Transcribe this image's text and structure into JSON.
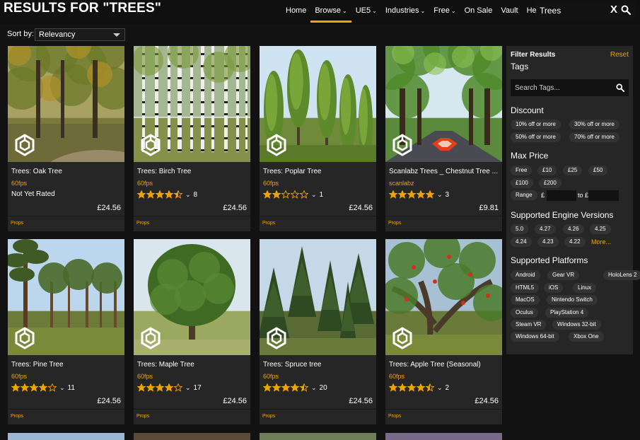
{
  "header": {
    "title": "RESULTS FOR \"TREES\"",
    "nav": [
      {
        "label": "Home",
        "caret": false,
        "active": false
      },
      {
        "label": "Browse",
        "caret": true,
        "active": true
      },
      {
        "label": "UE5",
        "caret": true,
        "active": false
      },
      {
        "label": "Industries",
        "caret": true,
        "active": false
      },
      {
        "label": "Free",
        "caret": true,
        "active": false
      },
      {
        "label": "On Sale",
        "caret": false,
        "active": false
      },
      {
        "label": "Vault",
        "caret": false,
        "active": false
      },
      {
        "label": "Help",
        "caret": false,
        "active": false
      }
    ],
    "search_value": "Trees",
    "clear_glyph": "X"
  },
  "sort": {
    "label": "Sort by:",
    "selected": "Relevancy"
  },
  "products": [
    {
      "title": "Trees: Oak Tree",
      "seller": "60fps",
      "rating": null,
      "unrated_text": "Not Yet Rated",
      "count": "",
      "price": "£24.56",
      "category": "Props",
      "scene": "oak"
    },
    {
      "title": "Trees: Birch Tree",
      "seller": "60fps",
      "rating": 4.5,
      "unrated_text": "",
      "count": "8",
      "price": "£24.56",
      "category": "Props",
      "scene": "birch"
    },
    {
      "title": "Trees: Poplar Tree",
      "seller": "60fps",
      "rating": 2,
      "unrated_text": "",
      "count": "1",
      "price": "£24.56",
      "category": "Props",
      "scene": "poplar"
    },
    {
      "title": "Scanlabz Trees _ Chestnut Tree ...",
      "seller": "scanlabz",
      "rating": 5,
      "unrated_text": "",
      "count": "3",
      "price": "£9.81",
      "category": "Props",
      "scene": "chestnut"
    },
    {
      "title": "Trees: Pine Tree",
      "seller": "60fps",
      "rating": 4,
      "unrated_text": "",
      "count": "11",
      "price": "£24.56",
      "category": "Props",
      "scene": "pine"
    },
    {
      "title": "Trees: Maple Tree",
      "seller": "60fps",
      "rating": 4,
      "unrated_text": "",
      "count": "17",
      "price": "£24.56",
      "category": "Props",
      "scene": "maple"
    },
    {
      "title": "Trees: Spruce tree",
      "seller": "60fps",
      "rating": 4.5,
      "unrated_text": "",
      "count": "20",
      "price": "£24.56",
      "category": "Props",
      "scene": "spruce"
    },
    {
      "title": "Trees: Apple Tree (Seasonal)",
      "seller": "60fps",
      "rating": 4.5,
      "unrated_text": "",
      "count": "2",
      "price": "£24.56",
      "category": "Props",
      "scene": "apple"
    }
  ],
  "filters": {
    "title": "Filter Results",
    "reset": "Reset",
    "tags_heading": "Tags",
    "tags_placeholder": "Search Tags...",
    "discount_heading": "Discount",
    "discounts": [
      "10% off or more",
      "30% off or more",
      "50% off or more",
      "70% off or more"
    ],
    "price_heading": "Max Price",
    "prices": [
      "Free",
      "£10",
      "£25",
      "£50",
      "£100",
      "£200"
    ],
    "range_label": "Range",
    "range_currency": "£",
    "range_to": "to £",
    "engine_heading": "Supported Engine Versions",
    "engines": [
      "5.0",
      "4.27",
      "4.26",
      "4.25",
      "4.24",
      "4.23",
      "4.22"
    ],
    "engine_more": "More...",
    "platform_heading": "Supported Platforms",
    "platforms": [
      "Android",
      "Gear VR",
      "HoloLens 2",
      "HTML5",
      "iOS",
      "Linux",
      "MacOS",
      "Nintendo Switch",
      "Oculus",
      "PlayStation 4",
      "Steam VR",
      "Windows 32-bit",
      "Windows 64-bit",
      "Xbox One"
    ]
  },
  "colors": {
    "accent": "#f0a300",
    "panel": "#262626",
    "background": "#121212"
  },
  "icons": {
    "search": "magnifier-icon",
    "clear": "close-icon",
    "badge": "hexagon-logo-icon",
    "star": "star-icon"
  }
}
